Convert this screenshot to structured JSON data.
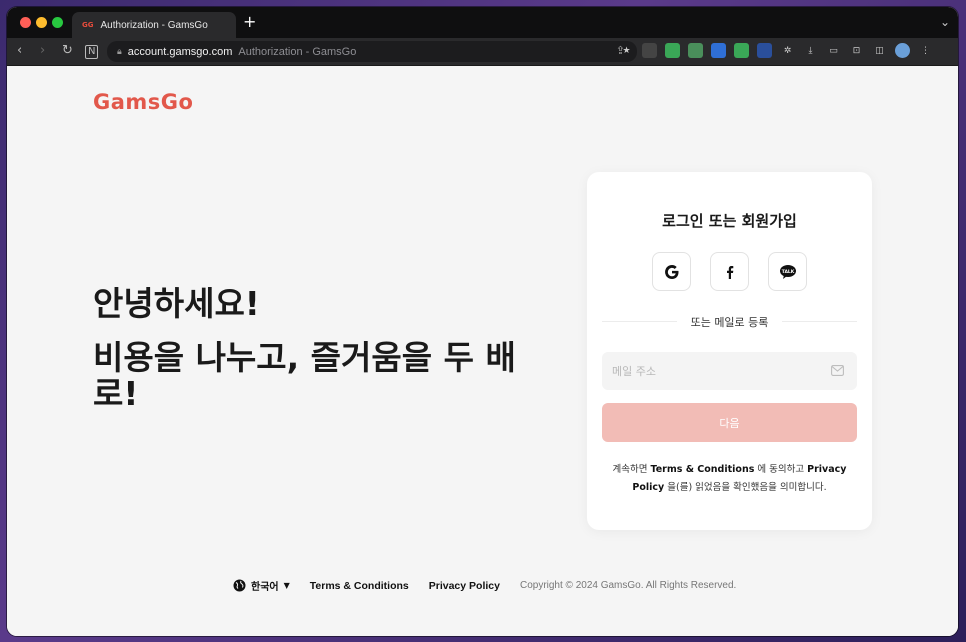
{
  "browser": {
    "tab_title": "Authorization - GamsGo",
    "tab_favicon": "GG",
    "new_tab_label": "+",
    "url_domain": "account.gamsgo.com",
    "url_page_title": "Authorization - GamsGo"
  },
  "site": {
    "logo": "GamsGo",
    "brand_color": "#e2584b"
  },
  "hero": {
    "greeting": "안녕하세요!",
    "tagline": "비용을 나누고, 즐거움을 두 배로!"
  },
  "login": {
    "title": "로그인 또는 회원가입",
    "social": [
      "google-icon",
      "facebook-icon",
      "kakaotalk-icon"
    ],
    "kakao_label": "TALK",
    "divider": "또는 메일로 등록",
    "email_placeholder": "메일 주소",
    "next_label": "다음",
    "terms_prefix": "계속하면 ",
    "terms_link": "Terms & Conditions",
    "terms_mid": " 에 동의하고 ",
    "privacy_link": "Privacy Policy",
    "terms_suffix": " 을(를) 읽었음을 확인했음을 의미합니다."
  },
  "footer": {
    "language": "한국어",
    "terms": "Terms & Conditions",
    "privacy": "Privacy Policy",
    "copyright": "Copyright © 2024 GamsGo. All Rights Reserved."
  }
}
